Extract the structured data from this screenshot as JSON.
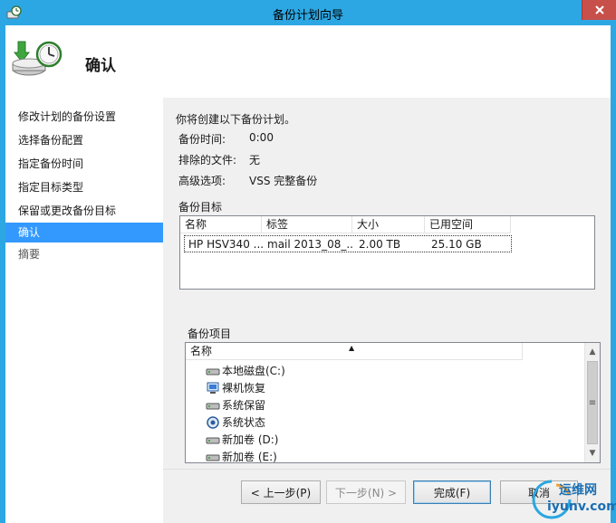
{
  "window": {
    "title": "备份计划向导"
  },
  "header": {
    "title": "确认"
  },
  "nav": {
    "items": [
      {
        "label": "修改计划的备份设置",
        "state": "normal"
      },
      {
        "label": "选择备份配置",
        "state": "normal"
      },
      {
        "label": "指定备份时间",
        "state": "normal"
      },
      {
        "label": "指定目标类型",
        "state": "normal"
      },
      {
        "label": "保留或更改备份目标",
        "state": "normal"
      },
      {
        "label": "确认",
        "state": "active"
      },
      {
        "label": "摘要",
        "state": "muted"
      }
    ]
  },
  "summary": {
    "intro": "你将创建以下备份计划。",
    "rows": [
      {
        "label": "备份时间:",
        "value": "0:00"
      },
      {
        "label": "排除的文件:",
        "value": "无"
      },
      {
        "label": "高级选项:",
        "value": "VSS 完整备份"
      }
    ]
  },
  "destination": {
    "label": "备份目标",
    "columns": [
      "名称",
      "标签",
      "大小",
      "已用空间"
    ],
    "rows": [
      [
        "HP HSV340 ...",
        "mail 2013_08_...",
        "2.00 TB",
        "25.10 GB"
      ]
    ]
  },
  "items": {
    "label": "备份项目",
    "column": "名称",
    "sort_glyph": "▲",
    "entries": [
      {
        "label": "本地磁盘(C:)",
        "icon": "drive-icon"
      },
      {
        "label": "裸机恢复",
        "icon": "bare-metal-icon"
      },
      {
        "label": "系统保留",
        "icon": "drive-icon"
      },
      {
        "label": "系统状态",
        "icon": "system-state-icon"
      },
      {
        "label": "新加卷 (D:)",
        "icon": "drive-icon"
      },
      {
        "label": "新加卷 (E:)",
        "icon": "drive-icon"
      }
    ],
    "scroll": {
      "up": "▲",
      "down": "▼",
      "grip": "≡"
    }
  },
  "buttons": {
    "back": "< 上一步(P)",
    "next": "下一步(N) >",
    "finish": "完成(F)",
    "cancel": "取消"
  },
  "watermark": {
    "line1": "运维网",
    "line2": "iyunv.com"
  },
  "colors": {
    "titlebar": "#2ca7e3",
    "selection": "#3399ff",
    "close": "#c7504a"
  }
}
